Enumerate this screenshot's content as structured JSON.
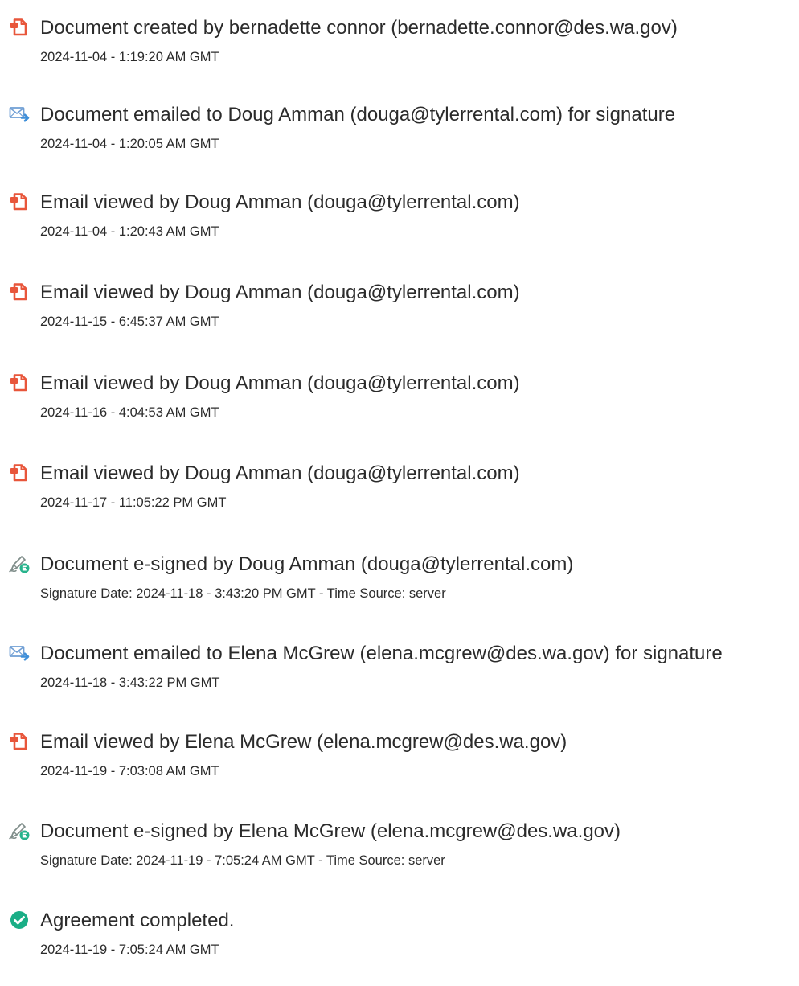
{
  "colors": {
    "pdf_icon": "#e8563b",
    "email_icon_blue": "#3f8fd9",
    "esign_icon_green": "#27b38c",
    "complete_icon_green": "#1aae86",
    "text": "#2b2b2b"
  },
  "events": [
    {
      "icon": "pdf-document-icon",
      "title": "Document created by bernadette connor (bernadette.connor@des.wa.gov)",
      "date": "2024-11-04 - 1:19:20 AM GMT"
    },
    {
      "icon": "email-sent-icon",
      "title": "Document emailed to Doug Amman (douga@tylerrental.com) for signature",
      "date": "2024-11-04 - 1:20:05 AM GMT"
    },
    {
      "icon": "pdf-document-icon",
      "title": "Email viewed by Doug Amman (douga@tylerrental.com)",
      "date": "2024-11-04 - 1:20:43 AM GMT"
    },
    {
      "icon": "pdf-document-icon",
      "title": "Email viewed by Doug Amman (douga@tylerrental.com)",
      "date": "2024-11-15 - 6:45:37 AM GMT"
    },
    {
      "icon": "pdf-document-icon",
      "title": "Email viewed by Doug Amman (douga@tylerrental.com)",
      "date": "2024-11-16 - 4:04:53 AM GMT"
    },
    {
      "icon": "pdf-document-icon",
      "title": "Email viewed by Doug Amman (douga@tylerrental.com)",
      "date": "2024-11-17 - 11:05:22 PM GMT"
    },
    {
      "icon": "esign-pen-icon",
      "title": "Document e-signed by Doug Amman (douga@tylerrental.com)",
      "date": "Signature Date: 2024-11-18 - 3:43:20 PM GMT - Time Source: server"
    },
    {
      "icon": "email-sent-icon",
      "title": "Document emailed to Elena McGrew (elena.mcgrew@des.wa.gov) for signature",
      "date": "2024-11-18 - 3:43:22 PM GMT"
    },
    {
      "icon": "pdf-document-icon",
      "title": "Email viewed by Elena McGrew (elena.mcgrew@des.wa.gov)",
      "date": "2024-11-19 - 7:03:08 AM GMT"
    },
    {
      "icon": "esign-pen-icon",
      "title": "Document e-signed by Elena McGrew (elena.mcgrew@des.wa.gov)",
      "date": "Signature Date: 2024-11-19 - 7:05:24 AM GMT - Time Source: server"
    },
    {
      "icon": "checkmark-circle-icon",
      "title": "Agreement completed.",
      "date": "2024-11-19 - 7:05:24 AM GMT"
    }
  ]
}
